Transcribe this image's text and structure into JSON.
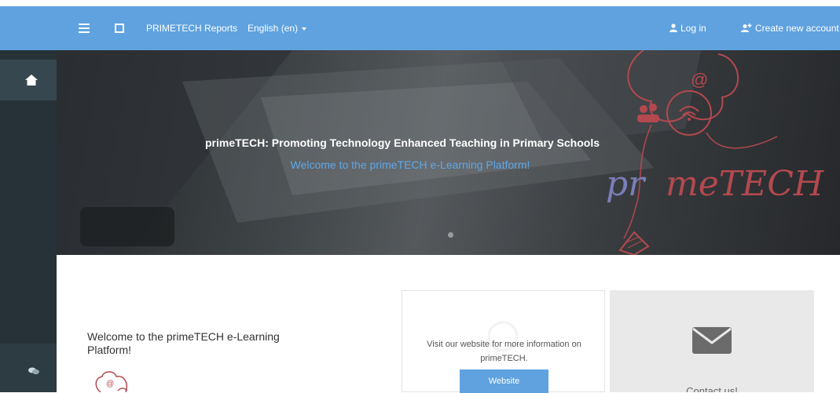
{
  "topbar": {
    "site_name": "PRIMETECH Reports",
    "language": "English (en)",
    "login": "Log in",
    "create_account": "Create new account"
  },
  "hero": {
    "title": "primeTECH: Promoting Technology Enhanced Teaching in Primary Schools",
    "subtitle": "Welcome to the primeTECH e-Learning Platform!",
    "logo_text": "primeTECH"
  },
  "welcome": {
    "heading": "Welcome to the primeTECH e-Learning Platform!"
  },
  "website_card": {
    "text": "Visit our website for more information on primeTECH.",
    "button": "Website"
  },
  "contact_card": {
    "text": "Contact us!"
  },
  "colors": {
    "brand": "#5fa2df",
    "drawer": "#263238",
    "accent_text": "#5fa8ea",
    "logo_red": "#b3494f",
    "logo_blue": "#7b7fb8"
  }
}
